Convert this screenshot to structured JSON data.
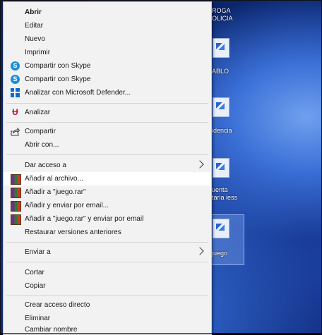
{
  "desktop": {
    "icon_labels": [
      {
        "line1": "ROGA",
        "line2": "OLICIA"
      },
      {
        "line1": "ABLO",
        "line2": ""
      },
      {
        "line1": "idencia",
        "line2": ""
      },
      {
        "line1": "uenta",
        "line2": "taria iess"
      },
      {
        "line1": "juego",
        "line2": ""
      }
    ]
  },
  "context_menu": {
    "items": [
      {
        "label": "Abrir",
        "icon": "none"
      },
      {
        "label": "Editar",
        "icon": "none"
      },
      {
        "label": "Nuevo",
        "icon": "none"
      },
      {
        "label": "Imprimir",
        "icon": "none"
      },
      {
        "label": "Compartir con Skype",
        "icon": "skype-icon"
      },
      {
        "label": "Compartir con Skype",
        "icon": "skype-icon"
      },
      {
        "label": "Analizar con Microsoft Defender...",
        "icon": "defender-icon"
      },
      {
        "label": "Analizar",
        "icon": "mcafee-icon"
      },
      {
        "label": "Compartir",
        "icon": "share-icon"
      },
      {
        "label": "Abrir con...",
        "icon": "none"
      },
      {
        "label": "Dar acceso a",
        "icon": "none"
      },
      {
        "label": "Añadir al archivo...",
        "icon": "winrar-icon"
      },
      {
        "label": "Añadir a \"juego.rar\"",
        "icon": "winrar-icon"
      },
      {
        "label": "Añadir y enviar por email...",
        "icon": "winrar-icon"
      },
      {
        "label": "Añadir a \"juego.rar\" y enviar por email",
        "icon": "winrar-icon"
      },
      {
        "label": "Restaurar versiones anteriores",
        "icon": "none"
      },
      {
        "label": "Enviar a",
        "icon": "none"
      },
      {
        "label": "Cortar",
        "icon": "none"
      },
      {
        "label": "Copiar",
        "icon": "none"
      },
      {
        "label": "Crear acceso directo",
        "icon": "none"
      },
      {
        "label": "Eliminar",
        "icon": "none"
      },
      {
        "label": "Cambiar nombre",
        "icon": "none"
      }
    ]
  }
}
